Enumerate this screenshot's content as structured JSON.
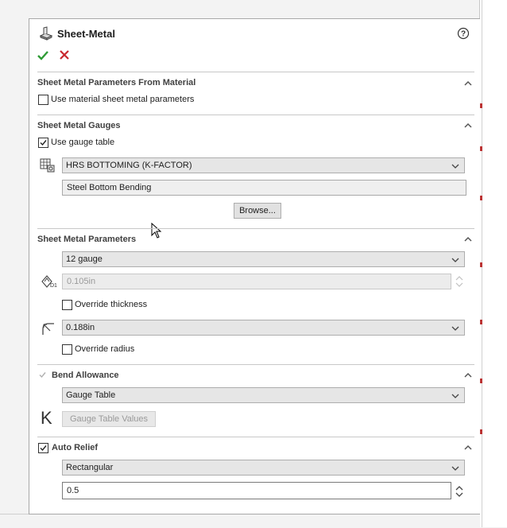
{
  "header": {
    "title": "Sheet-Metal",
    "help_icon": "help-icon",
    "ok_icon": "checkmark-icon",
    "cancel_icon": "close-icon"
  },
  "colors": {
    "ok": "#2e9b35",
    "cancel": "#c8272d",
    "chevron": "#555555"
  },
  "material_section": {
    "title": "Sheet Metal Parameters From Material",
    "use_material_label": "Use material sheet metal parameters",
    "use_material_checked": false
  },
  "gauges_section": {
    "title": "Sheet Metal Gauges",
    "use_gauge_label": "Use gauge table",
    "use_gauge_checked": true,
    "gauge_table_value": "HRS BOTTOMING (K-FACTOR)",
    "description_value": "Steel Bottom Bending",
    "browse_label": "Browse..."
  },
  "parameters_section": {
    "title": "Sheet Metal Parameters",
    "gauge_value": "12 gauge",
    "thickness_value": "0.105in",
    "override_thickness_label": "Override thickness",
    "override_thickness_checked": false,
    "radius_value": "0.188in",
    "override_radius_label": "Override radius",
    "override_radius_checked": false
  },
  "bend_section": {
    "title": "Bend Allowance",
    "checked": true,
    "type_value": "Gauge Table",
    "k_icon_label": "K",
    "values_button_label": "Gauge Table Values"
  },
  "relief_section": {
    "title": "Auto Relief",
    "checked": true,
    "type_value": "Rectangular",
    "ratio_value": "0.5"
  }
}
